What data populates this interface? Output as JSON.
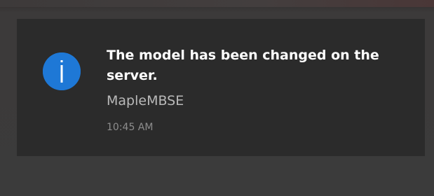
{
  "notification": {
    "title": "The model has been changed on the server.",
    "app_name": "MapleMBSE",
    "timestamp": "10:45 AM",
    "icon": "info-icon",
    "icon_color": "#1e78d6",
    "background_color": "#2b2b2b"
  }
}
